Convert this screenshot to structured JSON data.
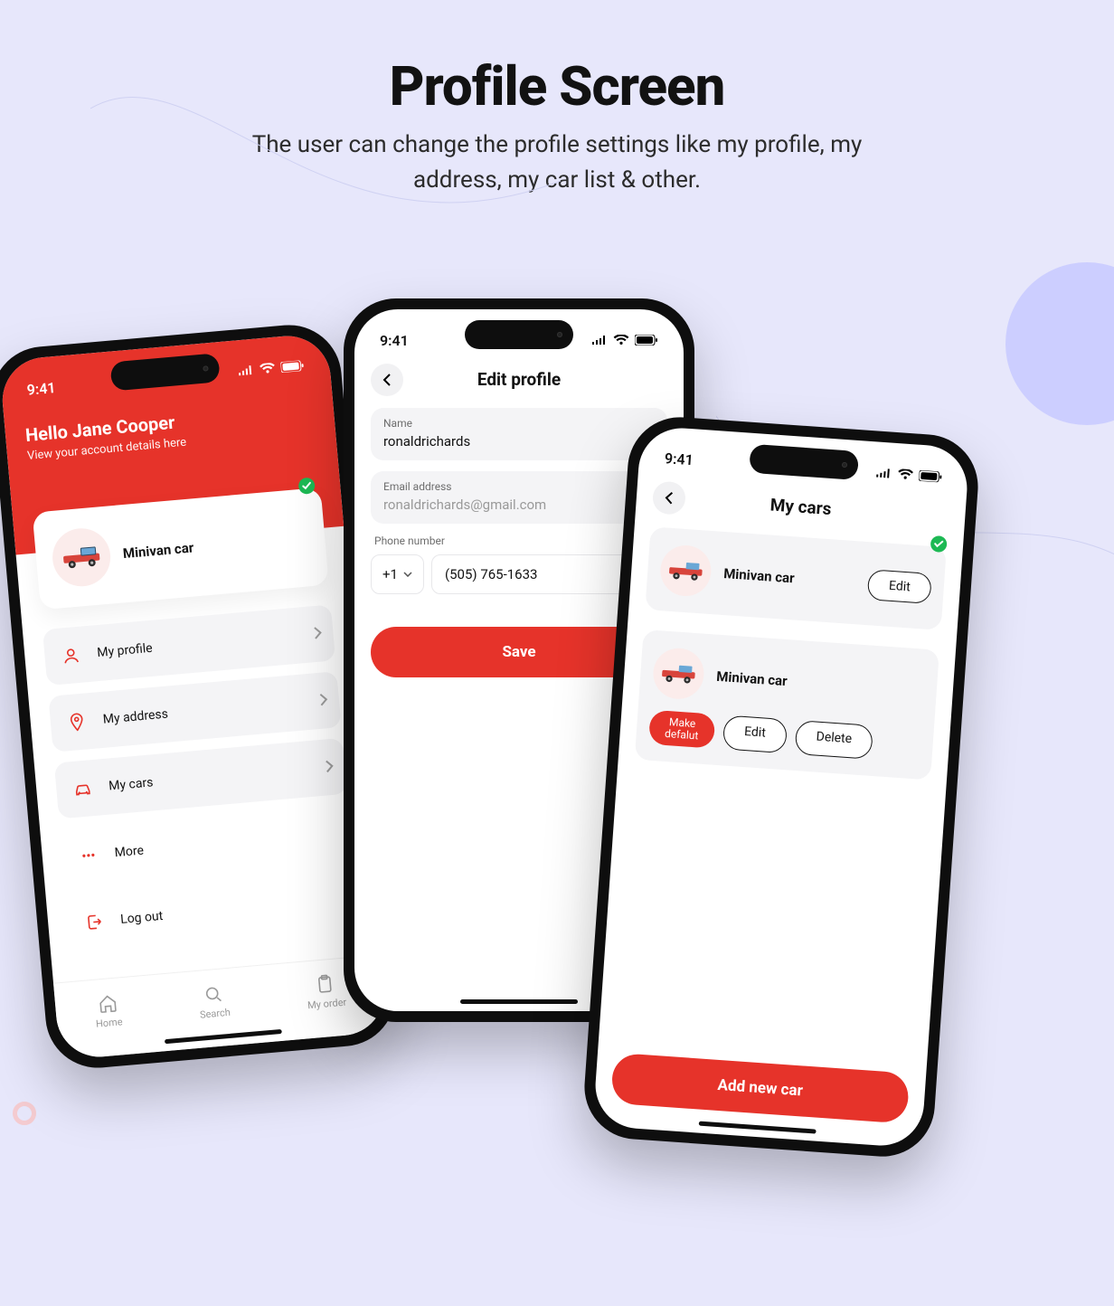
{
  "page": {
    "title": "Profile Screen",
    "subtitle": "The user can change the profile settings like my profile, my address, my car list & other."
  },
  "common": {
    "time": "9:41"
  },
  "screenA": {
    "greeting": "Hello Jane Cooper",
    "subtitle": "View your account details here",
    "car_label": "Minivan car",
    "menu": {
      "profile": "My profile",
      "address": "My address",
      "cars": "My cars",
      "more": "More",
      "logout": "Log out"
    },
    "tabs": {
      "home": "Home",
      "search": "Search",
      "order": "My order"
    }
  },
  "screenB": {
    "title": "Edit profile",
    "name_label": "Name",
    "name_value": "ronaldrichards",
    "email_label": "Email address",
    "email_placeholder": "ronaldrichards@gmail.com",
    "phone_label": "Phone number",
    "country_code": "+1",
    "phone_value": "(505) 765-1633",
    "save": "Save"
  },
  "screenC": {
    "title": "My cars",
    "car1_label": "Minivan car",
    "car2_label": "Minivan car",
    "edit": "Edit",
    "delete": "Delete",
    "make_default": "Make defalut",
    "add": "Add new car"
  }
}
